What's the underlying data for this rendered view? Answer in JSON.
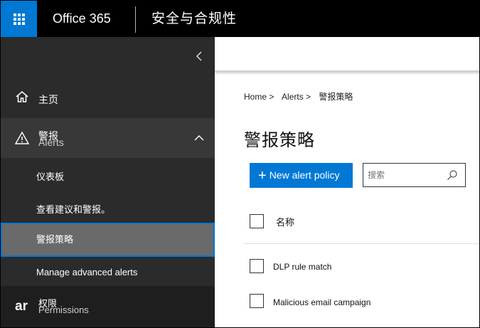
{
  "header": {
    "brand": "Office 365",
    "app_title": "安全与合规性"
  },
  "sidebar": {
    "home_label": "主页",
    "alerts_label_cn": "警报",
    "alerts_label_en": "Alerts",
    "items": [
      {
        "label": "仪表板"
      },
      {
        "label": "查看建议和警报。"
      },
      {
        "label": "警报策略",
        "selected": true
      },
      {
        "label": "Manage advanced alerts"
      }
    ],
    "permissions_icon_text": "ar",
    "permissions_label_cn": "权限",
    "permissions_label_en": "Permissions"
  },
  "main": {
    "breadcrumb": [
      "Home >",
      "Alerts >",
      "警报策略"
    ],
    "title": "警报策略",
    "new_button_label": "New alert policy",
    "search_placeholder": "搜索",
    "column_header": "名称",
    "rows": [
      {
        "name": "DLP rule match"
      },
      {
        "name": "Malicious email campaign"
      }
    ]
  },
  "colors": {
    "accent": "#0078d4",
    "topbar": "#000000",
    "sidebar": "#2b2b2b",
    "selected_item": "#6a6a6a"
  }
}
